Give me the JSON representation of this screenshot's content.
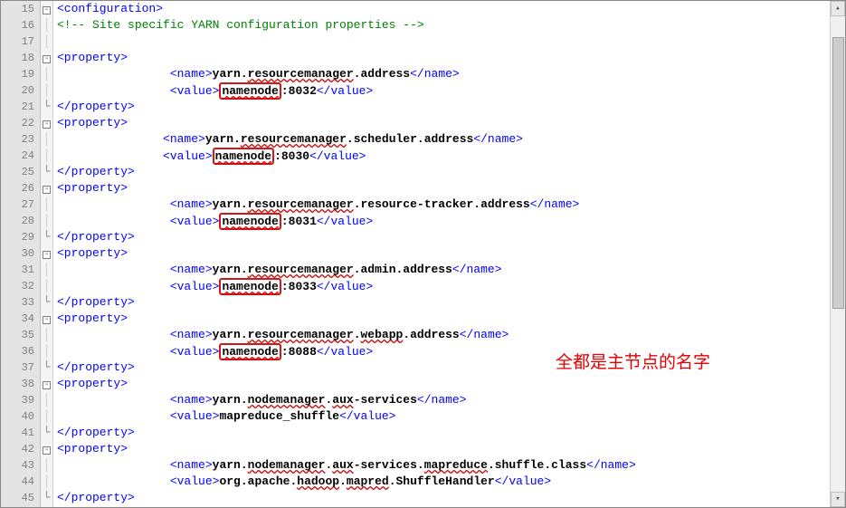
{
  "startLine": 15,
  "annotation": "全都是主节点的名字",
  "lines": {
    "l15": {
      "fold": "E",
      "html": "<span class='t'>&lt;configuration&gt;</span>"
    },
    "l16": {
      "fold": " ",
      "html": "<span class='c'>&lt;!-- Site specific YARN configuration properties --&gt;</span>"
    },
    "l17": {
      "fold": " ",
      "html": ""
    },
    "l18": {
      "fold": "E",
      "html": "<span class='t'>&lt;property&gt;</span>"
    },
    "l19": {
      "fold": " ",
      "html": "                <span class='t'>&lt;name&gt;</span><span class='k'><b>yarn.<span class='sq'>resourcemanager</span>.address</b></span><span class='t'>&lt;/name&gt;</span>"
    },
    "l20": {
      "fold": " ",
      "html": "                <span class='t'>&lt;value&gt;</span><b><span class='hlbox'><span class='sq'>namenode</span></span>:8032</b><span class='t'>&lt;/value&gt;</span>"
    },
    "l21": {
      "fold": "-",
      "html": "<span class='t'>&lt;/property&gt;</span>"
    },
    "l22": {
      "fold": "E",
      "html": "<span class='t'>&lt;property&gt;</span>"
    },
    "l23": {
      "fold": " ",
      "html": "               <span class='t'>&lt;name&gt;</span><span class='k'><b>yarn.<span class='sq'>resourcemanager</span>.scheduler.address</b></span><span class='t'>&lt;/name&gt;</span>"
    },
    "l24": {
      "fold": " ",
      "html": "               <span class='t'>&lt;value&gt;</span><b><span class='hlbox'><span class='sq'>namenode</span></span>:8030</b><span class='t'>&lt;/value&gt;</span>"
    },
    "l25": {
      "fold": "-",
      "html": "<span class='t'>&lt;/property&gt;</span>"
    },
    "l26": {
      "fold": "E",
      "html": "<span class='t'>&lt;property&gt;</span>"
    },
    "l27": {
      "fold": " ",
      "html": "                <span class='t'>&lt;name&gt;</span><span class='k'><b>yarn.<span class='sq'>resourcemanager</span>.resource-tracker.address</b></span><span class='t'>&lt;/name&gt;</span>"
    },
    "l28": {
      "fold": " ",
      "html": "                <span class='t'>&lt;value&gt;</span><b><span class='hlbox'><span class='sq'>namenode</span></span>:8031</b><span class='t'>&lt;/value&gt;</span>"
    },
    "l29": {
      "fold": "-",
      "html": "<span class='t'>&lt;/property&gt;</span>"
    },
    "l30": {
      "fold": "E",
      "html": "<span class='t'>&lt;property&gt;</span>"
    },
    "l31": {
      "fold": " ",
      "html": "                <span class='t'>&lt;name&gt;</span><span class='k'><b>yarn.<span class='sq'>resourcemanager</span>.admin.address</b></span><span class='t'>&lt;/name&gt;</span>"
    },
    "l32": {
      "fold": " ",
      "html": "                <span class='t'>&lt;value&gt;</span><b><span class='hlbox'><span class='sq'>namenode</span></span>:8033</b><span class='t'>&lt;/value&gt;</span>"
    },
    "l33": {
      "fold": "-",
      "html": "<span class='t'>&lt;/property&gt;</span>"
    },
    "l34": {
      "fold": "E",
      "html": "<span class='t'>&lt;property&gt;</span>"
    },
    "l35": {
      "fold": " ",
      "html": "                <span class='t'>&lt;name&gt;</span><span class='k'><b>yarn.<span class='sq'>resourcemanager</span>.<span class='sq'>webapp</span>.address</b></span><span class='t'>&lt;/name&gt;</span>"
    },
    "l36": {
      "fold": " ",
      "html": "                <span class='t'>&lt;value&gt;</span><b><span class='hlbox'><span class='sq'>namenode</span></span>:8088</b><span class='t'>&lt;/value&gt;</span>"
    },
    "l37": {
      "fold": "-",
      "html": "<span class='t'>&lt;/property&gt;</span>"
    },
    "l38": {
      "fold": "E",
      "html": "<span class='t'>&lt;property&gt;</span>"
    },
    "l39": {
      "fold": " ",
      "html": "                <span class='t'>&lt;name&gt;</span><span class='k'><b>yarn.<span class='sq'>nodemanager</span>.<span class='sq'>aux</span>-services</b></span><span class='t'>&lt;/name&gt;</span>"
    },
    "l40": {
      "fold": " ",
      "html": "                <span class='t'>&lt;value&gt;</span><b>mapreduce_shuffle</b><span class='t'>&lt;/value&gt;</span>"
    },
    "l41": {
      "fold": "-",
      "html": "<span class='t'>&lt;/property&gt;</span>"
    },
    "l42": {
      "fold": "E",
      "html": "<span class='t'>&lt;property&gt;</span>"
    },
    "l43": {
      "fold": " ",
      "html": "                <span class='t'>&lt;name&gt;</span><span class='k'><b>yarn.<span class='sq'>nodemanager</span>.<span class='sq'>aux</span>-services.<span class='sq'>mapreduce</span>.shuffle.class</b></span><span class='t'>&lt;/name&gt;</span>"
    },
    "l44": {
      "fold": " ",
      "html": "                <span class='t'>&lt;value&gt;</span><b>org.apache.<span class='sq'>hadoop</span>.<span class='sq'>mapred</span>.ShuffleHandler</b><span class='t'>&lt;/value&gt;</span>"
    },
    "l45": {
      "fold": "-",
      "html": "<span class='t'>&lt;/property&gt;</span>"
    }
  }
}
